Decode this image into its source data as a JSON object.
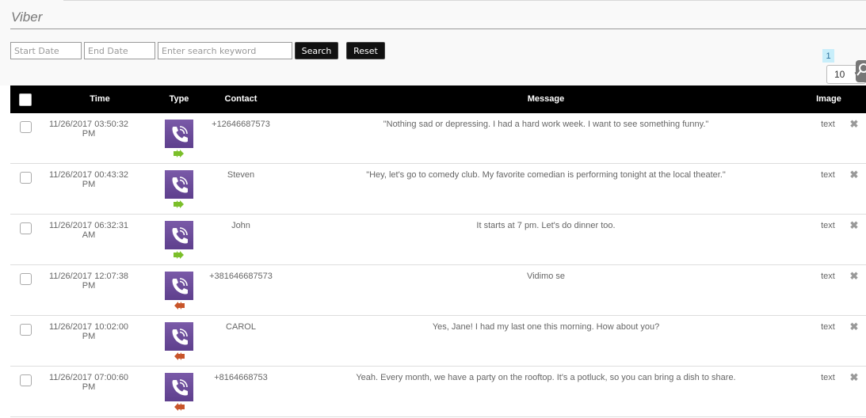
{
  "page": {
    "title": "Viber"
  },
  "filters": {
    "start_date_placeholder": "Start Date",
    "end_date_placeholder": "End Date",
    "search_placeholder": "Enter search keyword",
    "search_label": "Search",
    "reset_label": "Reset"
  },
  "pagination": {
    "current_page": "1",
    "per_page": "10"
  },
  "table": {
    "columns": [
      "Time",
      "Type",
      "Contact",
      "Message",
      "Image"
    ],
    "rows": [
      {
        "time": "11/26/2017 03:50:32 PM",
        "direction": "outgoing",
        "contact": "+12646687573",
        "message": "\"Nothing sad or depressing. I had a hard work week. I want to see something funny.\"",
        "image": "text"
      },
      {
        "time": "11/26/2017 00:43:32 PM",
        "direction": "outgoing",
        "contact": "Steven",
        "message": "\"Hey, let's go to comedy club. My favorite comedian is performing tonight at the local theater.\"",
        "image": "text"
      },
      {
        "time": "11/26/2017 06:32:31 AM",
        "direction": "outgoing",
        "contact": "John",
        "message": "It starts at 7 pm. Let's do dinner too.",
        "image": "text"
      },
      {
        "time": "11/26/2017 12:07:38 PM",
        "direction": "incoming",
        "contact": "+381646687573",
        "message": "Vidimo se",
        "image": "text"
      },
      {
        "time": "11/26/2017 10:02:00 PM",
        "direction": "incoming",
        "contact": "CAROL",
        "message": "Yes, Jane! I had my last one this morning. How about you?",
        "image": "text"
      },
      {
        "time": "11/26/2017 07:00:60 PM",
        "direction": "incoming",
        "contact": "+8164668753",
        "message": "Yeah. Every month, we have a party on the rooftop. It's a potluck, so you can bring a dish to share.",
        "image": "text"
      }
    ]
  },
  "icons": {
    "app_icon": "viber-icon",
    "outgoing": "double-arrow-right-icon",
    "incoming": "double-arrow-left-icon",
    "delete": "close-icon",
    "settings": "gear-icon"
  },
  "colors": {
    "viber_purple": "#6b4c9a",
    "outgoing_arrow": "#7bbf2a",
    "incoming_arrow": "#c8552a",
    "header_bg": "#000000"
  }
}
